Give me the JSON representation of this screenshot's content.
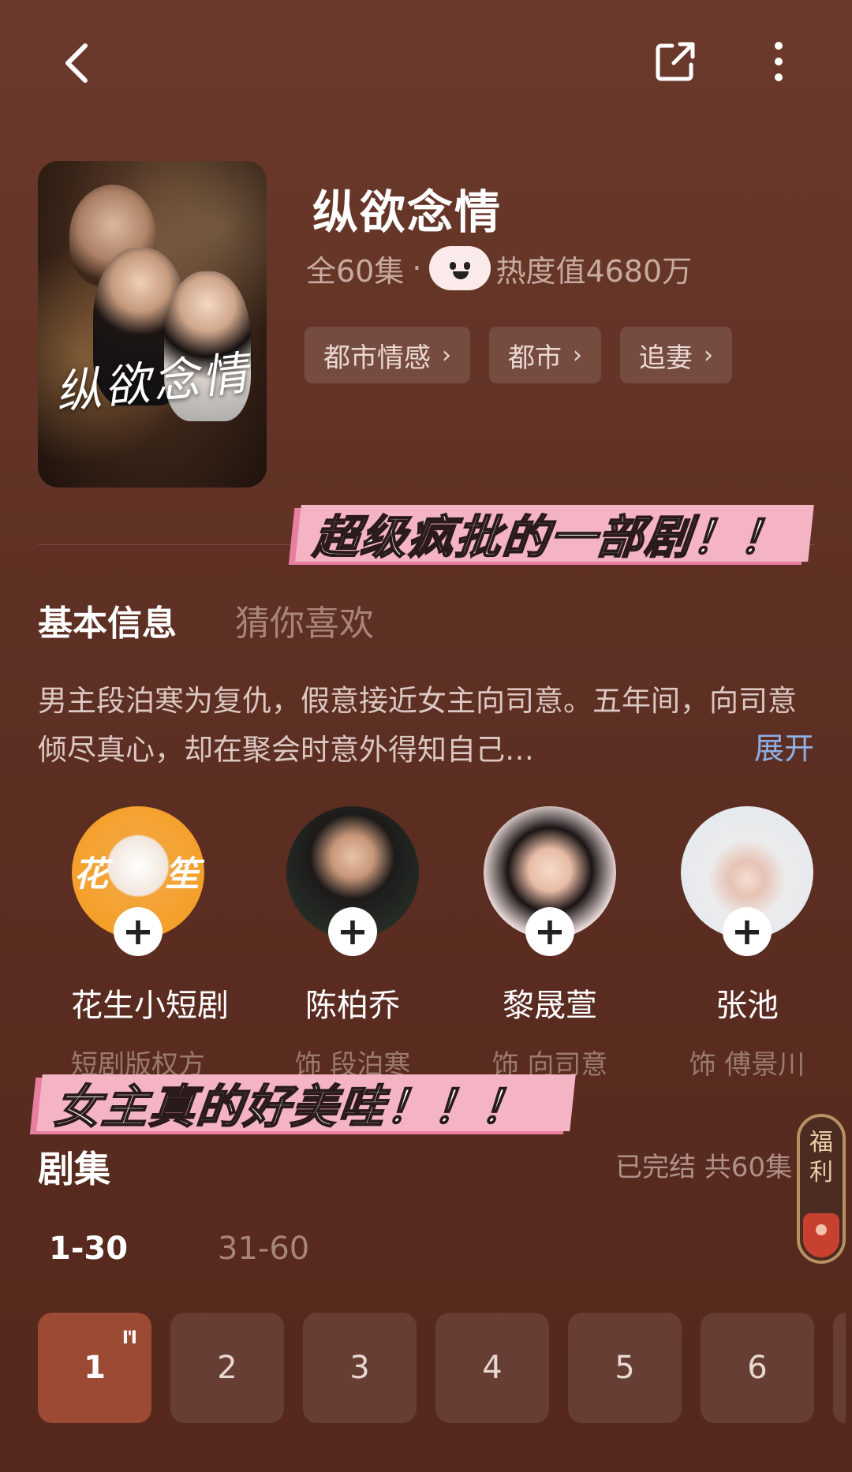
{
  "header": {
    "back_icon": "chevron-left-icon",
    "share_icon": "share-icon",
    "more_icon": "more-vertical-icon"
  },
  "drama": {
    "poster_title": "纵欲念情",
    "title": "纵欲念情",
    "episodes_total": "全60集",
    "separator": "·",
    "heat": "热度值4680万",
    "tags": [
      "都市情感",
      "都市",
      "追妻"
    ]
  },
  "stickers": {
    "top": "超级疯批的一部剧！！",
    "mid": "女主真的好美哇！！！"
  },
  "tabs": {
    "basic": "基本信息",
    "recommend": "猜你喜欢"
  },
  "synopsis": {
    "text": "男主段泊寒为复仇，假意接近女主向司意。五年间，向司意倾尽真心，却在聚会时意外得知自己…",
    "expand": "展开"
  },
  "cast": [
    {
      "name": "花生小短剧",
      "role": "短剧版权方",
      "brand_left": "花",
      "brand_right": "笙"
    },
    {
      "name": "陈柏乔",
      "role": "饰 段泊寒"
    },
    {
      "name": "黎晟萱",
      "role": "饰 向司意"
    },
    {
      "name": "张池",
      "role": "饰 傅景川"
    }
  ],
  "episodes": {
    "title": "剧集",
    "status": "已完结 共60集",
    "ranges": [
      "1-30",
      "31-60"
    ],
    "items": [
      "1",
      "2",
      "3",
      "4",
      "5",
      "6"
    ],
    "playing_glyph": "I'I"
  },
  "fuli": {
    "label": "福利"
  },
  "colors": {
    "accent": "#9c4a34",
    "link": "#8fb0e6",
    "sticker": "#f4b4c4"
  }
}
